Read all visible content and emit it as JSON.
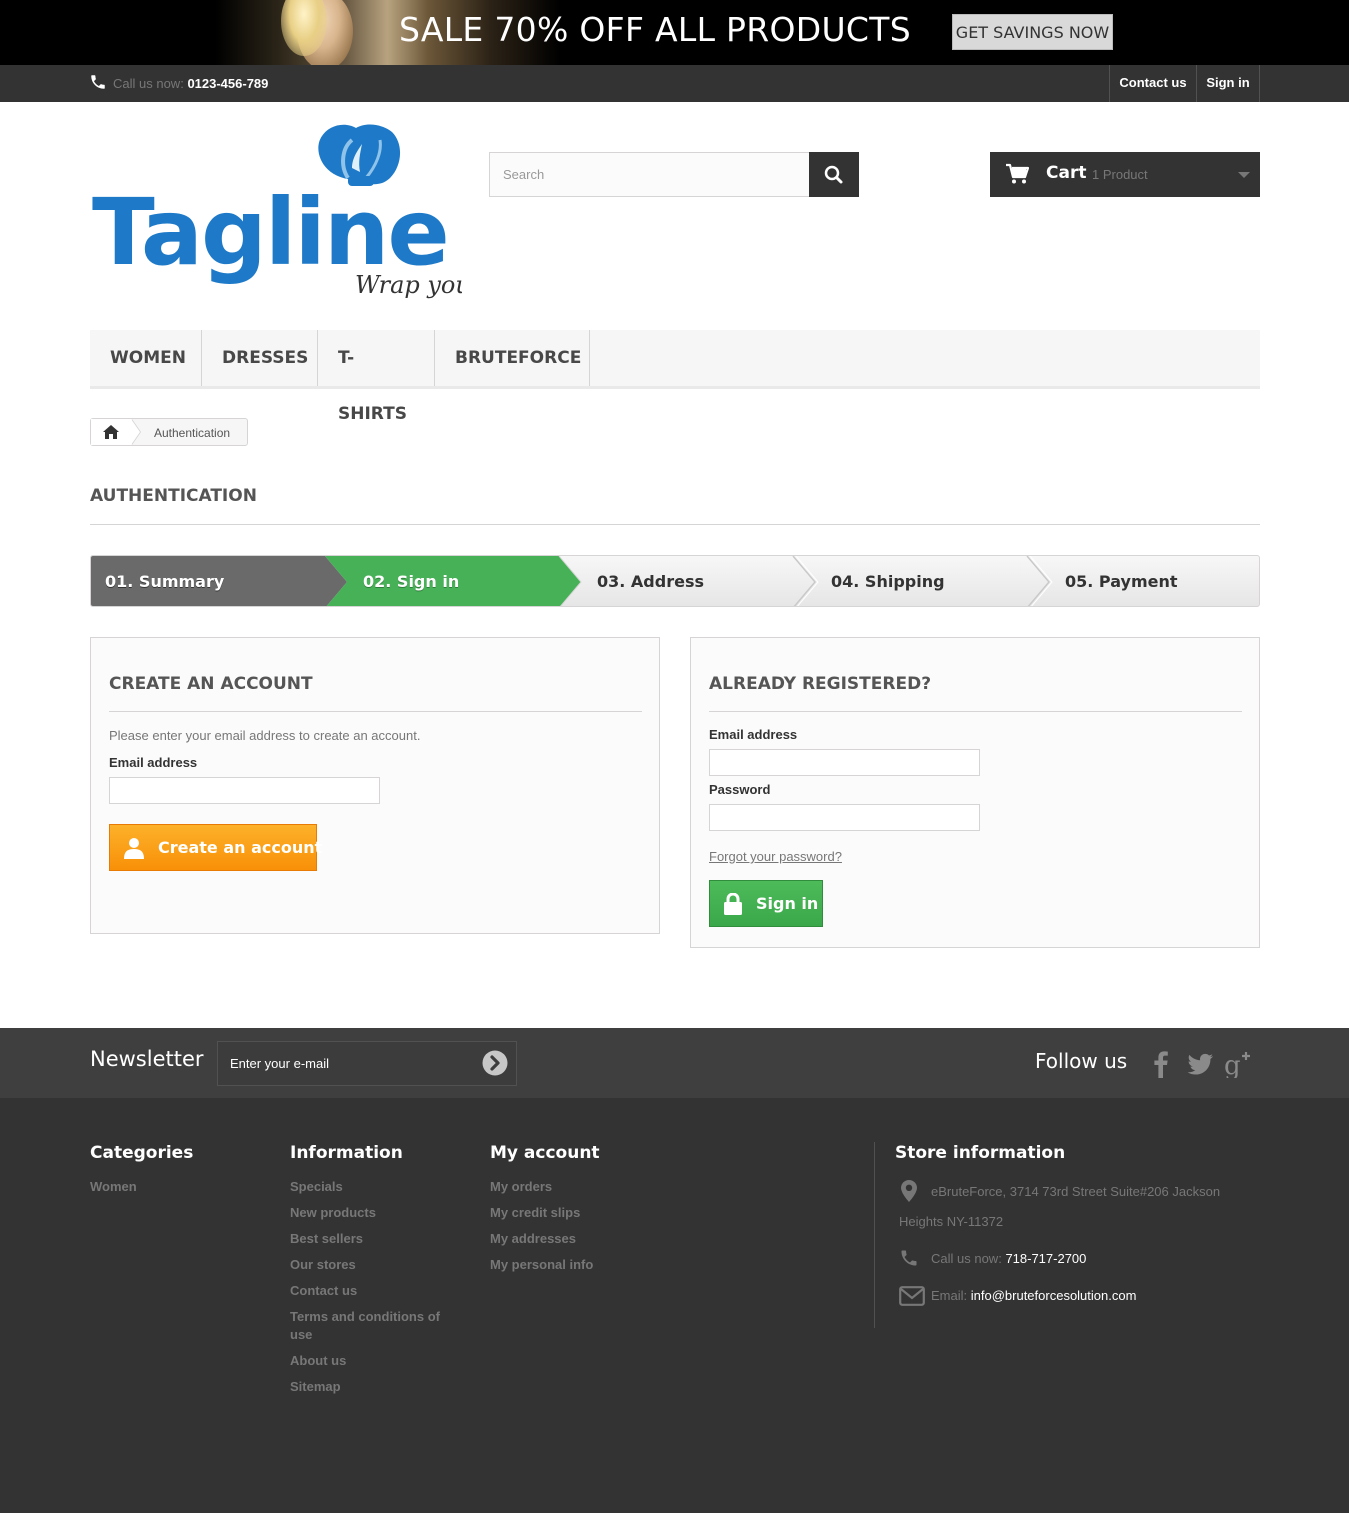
{
  "promo": {
    "headline": "SALE 70% OFF ALL PRODUCTS",
    "button_label": "GET SAVINGS NOW"
  },
  "topbar": {
    "call_label": "Call us now:",
    "phone": "0123-456-789",
    "contact_label": "Contact us",
    "signin_label": "Sign in"
  },
  "header": {
    "logo_text": "Tagline",
    "logo_tagline": "Wrap you",
    "search_placeholder": "Search",
    "cart_label": "Cart",
    "cart_count": "1 Product"
  },
  "menu": [
    "WOMEN",
    "DRESSES",
    "T-SHIRTS",
    "BRUTEFORCE"
  ],
  "breadcrumb": {
    "current": "Authentication"
  },
  "page": {
    "title": "AUTHENTICATION"
  },
  "steps": [
    {
      "label": "01. Summary",
      "state": "done"
    },
    {
      "label": "02. Sign in",
      "state": "current"
    },
    {
      "label": "03. Address",
      "state": "todo"
    },
    {
      "label": "04. Shipping",
      "state": "todo"
    },
    {
      "label": "05. Payment",
      "state": "todo"
    }
  ],
  "colors": {
    "step_done": "#6a6a6a",
    "step_current": "#46b156",
    "create_button": "#f99c13",
    "signin_button": "#43b155",
    "dark": "#333333",
    "logo_blue": "#1e7ac8"
  },
  "create_account": {
    "title": "CREATE AN ACCOUNT",
    "description": "Please enter your email address to create an account.",
    "email_label": "Email address",
    "email_value": "",
    "button_label": "Create an account"
  },
  "login": {
    "title": "ALREADY REGISTERED?",
    "email_label": "Email address",
    "email_value": "",
    "password_label": "Password",
    "password_value": "",
    "forgot_label": "Forgot your password?",
    "button_label": "Sign in"
  },
  "newsletter": {
    "title": "Newsletter",
    "placeholder": "Enter your e-mail",
    "follow_label": "Follow us"
  },
  "footer": {
    "categories": {
      "title": "Categories",
      "items": [
        "Women"
      ]
    },
    "information": {
      "title": "Information",
      "items": [
        "Specials",
        "New products",
        "Best sellers",
        "Our stores",
        "Contact us",
        "Terms and conditions of use",
        "About us",
        "Sitemap"
      ]
    },
    "my_account": {
      "title": "My account",
      "items": [
        "My orders",
        "My credit slips",
        "My addresses",
        "My personal info"
      ]
    },
    "store": {
      "title": "Store information",
      "address_line1": "eBruteForce, 3714 73rd Street Suite#206 Jackson",
      "address_line2": "Heights NY-11372",
      "call_label": "Call us now:",
      "phone": "718-717-2700",
      "email_label": "Email:",
      "email": "info@bruteforcesolution.com"
    }
  }
}
